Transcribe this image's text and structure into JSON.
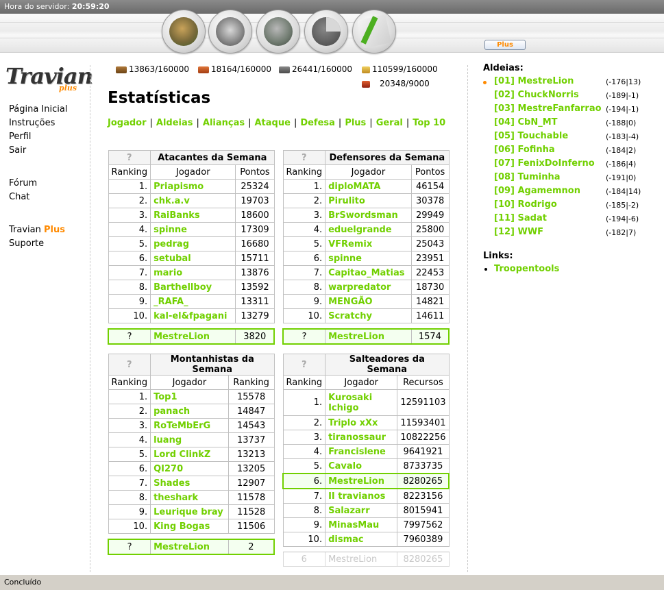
{
  "topbar": {
    "label": "Hora do servidor:",
    "time": "20:59:20"
  },
  "nav": {
    "plus_label": "Plus"
  },
  "logo": {
    "text": "Travian",
    "sub": "plus"
  },
  "leftmenu": {
    "home": "Página Inicial",
    "instructions": "Instruções",
    "profile": "Perfil",
    "logout": "Sair",
    "forum": "Fórum",
    "chat": "Chat",
    "travian": "Travian",
    "plus": "Plus",
    "support": "Suporte"
  },
  "resources": {
    "wood": "13863/160000",
    "clay": "18164/160000",
    "iron": "26441/160000",
    "crop": "110599/160000",
    "consumption": "20348/9000"
  },
  "page": {
    "title": "Estatísticas"
  },
  "menu": [
    "Jogador",
    "Aldeias",
    "Alianças",
    "Ataque",
    "Defesa",
    "Plus",
    "Geral",
    "Top 10"
  ],
  "attackers": {
    "title": "Atacantes da Semana",
    "q": "?",
    "cols": [
      "Ranking",
      "Jogador",
      "Pontos"
    ],
    "rows": [
      {
        "rank": "1.",
        "name": "Priapismo",
        "value": "25324"
      },
      {
        "rank": "2.",
        "name": "chk.a.v",
        "value": "19703"
      },
      {
        "rank": "3.",
        "name": "RaiBanks",
        "value": "18600"
      },
      {
        "rank": "4.",
        "name": "spinne",
        "value": "17309"
      },
      {
        "rank": "5.",
        "name": "pedrag",
        "value": "16680"
      },
      {
        "rank": "6.",
        "name": "setubal",
        "value": "15711"
      },
      {
        "rank": "7.",
        "name": "mario",
        "value": "13876"
      },
      {
        "rank": "8.",
        "name": "Barthellboy",
        "value": "13592"
      },
      {
        "rank": "9.",
        "name": "_RAFA_",
        "value": "13311"
      },
      {
        "rank": "10.",
        "name": "kal-el&fpagani",
        "value": "13279"
      }
    ],
    "me": {
      "rank": "?",
      "name": "MestreLion",
      "value": "3820"
    }
  },
  "defenders": {
    "title": "Defensores da Semana",
    "q": "?",
    "cols": [
      "Ranking",
      "Jogador",
      "Pontos"
    ],
    "rows": [
      {
        "rank": "1.",
        "name": "diploMATA",
        "value": "46154"
      },
      {
        "rank": "2.",
        "name": "Pirulito",
        "value": "30378"
      },
      {
        "rank": "3.",
        "name": "BrSwordsman",
        "value": "29949"
      },
      {
        "rank": "4.",
        "name": "eduelgrande",
        "value": "25800"
      },
      {
        "rank": "5.",
        "name": "VFRemix",
        "value": "25043"
      },
      {
        "rank": "6.",
        "name": "spinne",
        "value": "23951"
      },
      {
        "rank": "7.",
        "name": "Capitao_Matias",
        "value": "22453"
      },
      {
        "rank": "8.",
        "name": "warpredator",
        "value": "18730"
      },
      {
        "rank": "9.",
        "name": "MENGÃO",
        "value": "14821"
      },
      {
        "rank": "10.",
        "name": "Scratchy",
        "value": "14611"
      }
    ],
    "me": {
      "rank": "?",
      "name": "MestreLion",
      "value": "1574"
    }
  },
  "climbers": {
    "title": "Montanhistas da Semana",
    "q": "?",
    "cols": [
      "Ranking",
      "Jogador",
      "Ranking"
    ],
    "rows": [
      {
        "rank": "1.",
        "name": "Top1",
        "value": "15578"
      },
      {
        "rank": "2.",
        "name": "panach",
        "value": "14847"
      },
      {
        "rank": "3.",
        "name": "RoTeMbErG",
        "value": "14543"
      },
      {
        "rank": "4.",
        "name": "luang",
        "value": "13737"
      },
      {
        "rank": "5.",
        "name": "Lord ClinkZ",
        "value": "13213"
      },
      {
        "rank": "6.",
        "name": "QI270",
        "value": "13205"
      },
      {
        "rank": "7.",
        "name": "Shades",
        "value": "12907"
      },
      {
        "rank": "8.",
        "name": "theshark",
        "value": "11578"
      },
      {
        "rank": "9.",
        "name": "Leurique bray",
        "value": "11528"
      },
      {
        "rank": "10.",
        "name": "King Bogas",
        "value": "11506"
      }
    ],
    "me": {
      "rank": "?",
      "name": "MestreLion",
      "value": "2"
    }
  },
  "robbers": {
    "title": "Salteadores da Semana",
    "q": "?",
    "cols": [
      "Ranking",
      "Jogador",
      "Recursos"
    ],
    "rows": [
      {
        "rank": "1.",
        "name": "Kurosaki Ichigo",
        "value": "12591103"
      },
      {
        "rank": "2.",
        "name": "Triplo xXx",
        "value": "11593401"
      },
      {
        "rank": "3.",
        "name": "tiranossaur",
        "value": "10822256"
      },
      {
        "rank": "4.",
        "name": "Francislene",
        "value": "9641921"
      },
      {
        "rank": "5.",
        "name": "Cavalo",
        "value": "8733735"
      },
      {
        "rank": "6.",
        "name": "MestreLion",
        "value": "8280265"
      },
      {
        "rank": "7.",
        "name": "II travianos",
        "value": "8223156"
      },
      {
        "rank": "8.",
        "name": "Salazarr",
        "value": "8015941"
      },
      {
        "rank": "9.",
        "name": "MinasMau",
        "value": "7997562"
      },
      {
        "rank": "10.",
        "name": "dismac",
        "value": "7960389"
      }
    ],
    "me": {
      "rank": "6",
      "name": "MestreLion",
      "value": "8280265"
    }
  },
  "villages": {
    "title": "Aldeias:",
    "items": [
      {
        "name": "[01] MestreLion",
        "coords": "(-176|13)"
      },
      {
        "name": "[02] ChuckNorris",
        "coords": "(-189|-1)"
      },
      {
        "name": "[03] MestreFanfarrao",
        "coords": "(-194|-1)"
      },
      {
        "name": "[04] CbN_MT",
        "coords": "(-188|0)"
      },
      {
        "name": "[05] Touchable",
        "coords": "(-183|-4)"
      },
      {
        "name": "[06] Fofinha",
        "coords": "(-184|2)"
      },
      {
        "name": "[07] FenixDoInferno",
        "coords": "(-186|4)"
      },
      {
        "name": "[08] Tuminha",
        "coords": "(-191|0)"
      },
      {
        "name": "[09] Agamemnon",
        "coords": "(-184|14)"
      },
      {
        "name": "[10] Rodrigo",
        "coords": "(-185|-2)"
      },
      {
        "name": "[11] Sadat",
        "coords": "(-194|-6)"
      },
      {
        "name": "[12] WWF",
        "coords": "(-182|7)"
      }
    ]
  },
  "links": {
    "title": "Links:",
    "items": [
      "Troopentools"
    ]
  },
  "statusbar": {
    "text": "Concluído"
  }
}
